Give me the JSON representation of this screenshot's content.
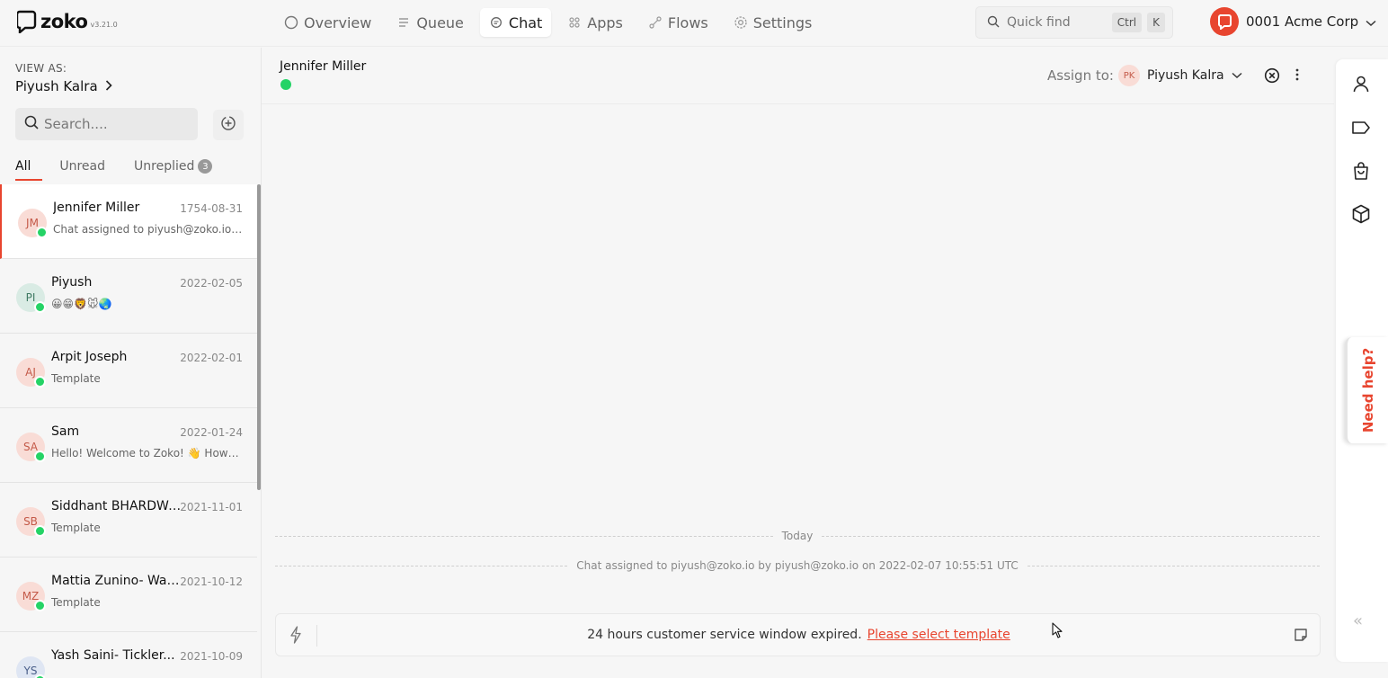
{
  "app": {
    "name": "zoko",
    "version": "v3.21.0",
    "accent_color": "#e8452f",
    "whatsapp_color": "#25d366"
  },
  "nav": {
    "items": [
      {
        "label": "Overview",
        "icon": "circle-icon"
      },
      {
        "label": "Queue",
        "icon": "queue-icon"
      },
      {
        "label": "Chat",
        "icon": "chat-icon",
        "active": true
      },
      {
        "label": "Apps",
        "icon": "apps-grid-icon"
      },
      {
        "label": "Flows",
        "icon": "flows-icon"
      },
      {
        "label": "Settings",
        "icon": "gear-icon"
      }
    ]
  },
  "quick_find": {
    "placeholder": "Quick find",
    "keys": [
      "Ctrl",
      "K"
    ]
  },
  "org": {
    "name": "0001 Acme Corp"
  },
  "sidebar": {
    "view_as_label": "VIEW AS:",
    "view_as_user": "Piyush Kalra",
    "search_placeholder": "Search....",
    "tabs": [
      {
        "label": "All",
        "active": true
      },
      {
        "label": "Unread"
      },
      {
        "label": "Unreplied",
        "count": "3"
      }
    ],
    "chats": [
      {
        "initials": "JM",
        "name": "Jennifer Miller",
        "date": "1754-08-31",
        "preview": "Chat assigned to piyush@zoko.io ...",
        "active": true,
        "avatar_bg": "#f9dcd6",
        "avatar_fg": "#c45a49"
      },
      {
        "initials": "PI",
        "name": "Piyush",
        "date": "2022-02-05",
        "preview": "😀😁🦁🐭🌏",
        "avatar_bg": "#d9ebe4",
        "avatar_fg": "#3f7a63"
      },
      {
        "initials": "AJ",
        "name": "Arpit Joseph",
        "date": "2022-02-01",
        "preview": "Template",
        "avatar_bg": "#f9dcd6",
        "avatar_fg": "#c45a49"
      },
      {
        "initials": "SA",
        "name": "Sam",
        "date": "2022-01-24",
        "preview": "Hello! Welcome to Zoko! 👋 How c...",
        "avatar_bg": "#f9dcd6",
        "avatar_fg": "#c45a49"
      },
      {
        "initials": "SB",
        "name": "Siddhant BHARDWA...",
        "date": "2021-11-01",
        "preview": "Template",
        "avatar_bg": "#f9dcd6",
        "avatar_fg": "#c45a49"
      },
      {
        "initials": "MZ",
        "name": "Mattia Zunino- War...",
        "date": "2021-10-12",
        "preview": "Template",
        "avatar_bg": "#f9dcd6",
        "avatar_fg": "#c45a49"
      },
      {
        "initials": "YS",
        "name": "Yash Saini- Tickler...",
        "date": "2021-10-09",
        "preview": "",
        "avatar_bg": "#dfe6f3",
        "avatar_fg": "#4a5f8a"
      }
    ]
  },
  "conversation": {
    "contact_name": "Jennifer Miller",
    "assign_label": "Assign to:",
    "assignee_initials": "PK",
    "assignee_name": "Piyush Kalra",
    "day_separator": "Today",
    "system_message": "Chat assigned to piyush@zoko.io by piyush@zoko.io on 2022-02-07 10:55:51 UTC",
    "composer_notice": "24 hours customer service window expired.",
    "composer_link": "Please select template"
  },
  "right_rail": {
    "icons": [
      "user-icon",
      "tag-icon",
      "shopping-bag-icon",
      "box-icon"
    ],
    "help_label": "Need help?",
    "collapse_glyph": "«"
  }
}
